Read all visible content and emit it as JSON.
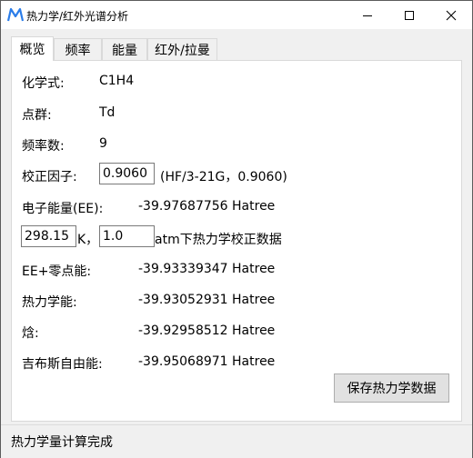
{
  "window": {
    "title": "热力学/红外光谱分析",
    "icon": "app-logo-icon",
    "controls": [
      "minimize-icon",
      "maximize-icon",
      "close-icon"
    ]
  },
  "tabs": [
    {
      "label": "概览",
      "active": true
    },
    {
      "label": "频率",
      "active": false
    },
    {
      "label": "能量",
      "active": false
    },
    {
      "label": "红外/拉曼",
      "active": false
    }
  ],
  "overview": {
    "formula_label": "化学式:",
    "formula_value": "C1H4",
    "point_group_label": "点群:",
    "point_group_value": "Td",
    "freq_count_label": "频率数:",
    "freq_count_value": "9",
    "scale_factor_label": "校正因子:",
    "scale_factor_input": "0.9060",
    "scale_factor_note": "(HF/3-21G，0.9060)",
    "ee_label": "电子能量(EE):",
    "ee_value": "-39.97687756 Hatree",
    "temperature_input": "298.15",
    "temperature_unit": "K，",
    "pressure_input": "1.0",
    "pressure_note": "atm下热力学校正数据",
    "ee_zpe_label": "EE+零点能:",
    "ee_zpe_value": "-39.93339347 Hatree",
    "thermal_energy_label": "热力学能:",
    "thermal_energy_value": "-39.93052931 Hatree",
    "enthalpy_label": "焓:",
    "enthalpy_value": "-39.92958512 Hatree",
    "gibbs_label": "吉布斯自由能:",
    "gibbs_value": "-39.95068971 Hatree",
    "save_button": "保存热力学数据"
  },
  "status": {
    "text": "热力学量计算完成"
  },
  "colors": {
    "logo": "#2b7de9",
    "window_bg": "#f0f0f0",
    "panel_bg": "#ffffff",
    "button_bg": "#e1e1e1"
  }
}
